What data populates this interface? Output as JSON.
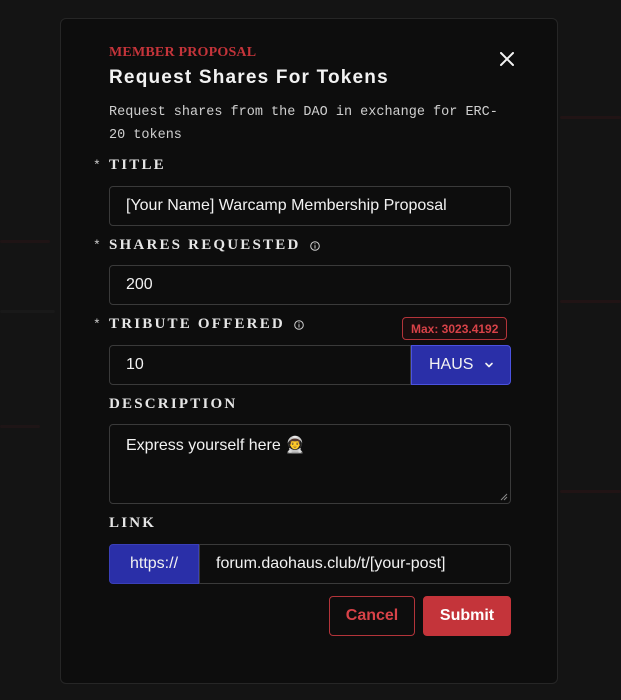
{
  "modal": {
    "eyebrow": "MEMBER PROPOSAL",
    "title": "Request Shares For Tokens",
    "subtitle": "Request shares from the DAO in exchange for ERC-20 tokens",
    "close_icon": "close-icon"
  },
  "fields": {
    "title": {
      "required": "*",
      "label": "TITLE",
      "value": "[Your Name] Warcamp Membership Proposal"
    },
    "shares": {
      "required": "*",
      "label": "SHARES REQUESTED",
      "value": "200",
      "icon": "info-icon"
    },
    "tribute": {
      "required": "*",
      "label": "TRIBUTE OFFERED",
      "value": "10",
      "icon": "info-icon",
      "max_badge": "Max: 3023.4192",
      "token": "HAUS",
      "token_icon": "chevron-down-icon"
    },
    "description": {
      "label": "DESCRIPTION",
      "value": "Express yourself here 👨‍🚀"
    },
    "link": {
      "label": "LINK",
      "prefix": "https://",
      "value": "forum.daohaus.club/t/[your-post]"
    }
  },
  "actions": {
    "cancel": "Cancel",
    "submit": "Submit"
  },
  "colors": {
    "accent_red": "#c4343a",
    "accent_blue": "#2a2fa8",
    "background": "#0d0d0d"
  }
}
